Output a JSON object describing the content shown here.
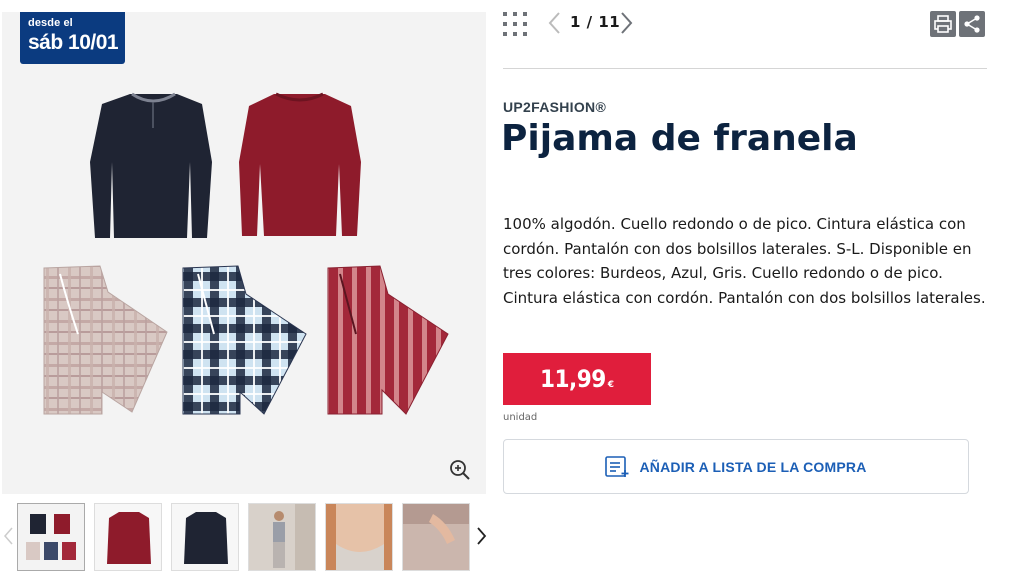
{
  "badge": {
    "line1": "desde el",
    "line2": "sáb 10/01"
  },
  "pager": {
    "current": 1,
    "total": 11,
    "label": "1 / 11"
  },
  "product": {
    "brand": "UP2FASHION®",
    "title": "Pijama de franela",
    "description": "100% algodón. Cuello redondo o de pico. Cintura elástica con cordón. Pantalón con dos bolsillos laterales. S-L. Disponible en tres colores: Burdeos, Azul, Gris. Cuello redondo o de pico. Cintura elástica con cordón. Pantalón con dos bolsillos laterales.",
    "price": "11,99",
    "currency": "€",
    "unit": "unidad"
  },
  "actions": {
    "add_to_list": "AÑADIR A LISTA DE LA COMPRA"
  },
  "icons": {
    "grid": "grid-icon",
    "prev": "chevron-left-icon",
    "next": "chevron-right-icon",
    "print": "print-icon",
    "share": "share-icon",
    "zoom": "zoom-in-icon",
    "list": "shopping-list-icon"
  },
  "colors": {
    "badge_bg": "#0b3b80",
    "title": "#0c2340",
    "price_bg": "#e01e3c",
    "action_text": "#1c5fb6",
    "icon_bg": "#6e7278"
  },
  "thumbnails": [
    {
      "name": "thumb-pajama-set",
      "active": true
    },
    {
      "name": "thumb-red-top",
      "active": false
    },
    {
      "name": "thumb-navy-top",
      "active": false
    },
    {
      "name": "thumb-model-full",
      "active": false
    },
    {
      "name": "thumb-neckline-detail",
      "active": false
    },
    {
      "name": "thumb-pocket-detail",
      "active": false
    }
  ]
}
